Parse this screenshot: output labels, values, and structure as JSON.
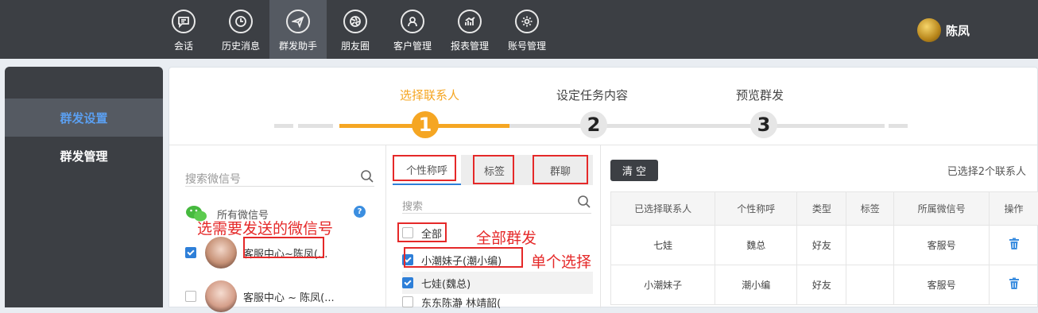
{
  "nav": {
    "items": [
      {
        "label": "会话",
        "icon": "chat-icon"
      },
      {
        "label": "历史消息",
        "icon": "clock-icon"
      },
      {
        "label": "群发助手",
        "icon": "paper-plane-icon",
        "active": true
      },
      {
        "label": "朋友圈",
        "icon": "aperture-icon"
      },
      {
        "label": "客户管理",
        "icon": "user-icon"
      },
      {
        "label": "报表管理",
        "icon": "chart-icon"
      },
      {
        "label": "账号管理",
        "icon": "gear-icon"
      }
    ],
    "user_name": "陈凤"
  },
  "sidebar": {
    "items": [
      {
        "label": "群发设置",
        "active": true
      },
      {
        "label": "群发管理",
        "active": false
      }
    ]
  },
  "steps": [
    {
      "label": "选择联系人",
      "number": "1",
      "active": true
    },
    {
      "label": "设定任务内容",
      "number": "2",
      "active": false
    },
    {
      "label": "预览群发",
      "number": "3",
      "active": false
    }
  ],
  "accounts_panel": {
    "search_placeholder": "搜索微信号",
    "all_label": "所有微信号",
    "help": "?",
    "note": "选需要发送的微信号",
    "accounts": [
      {
        "name": "客服中心~陈凤(...",
        "checked": true
      },
      {
        "name": "客服中心 ~ 陈凤(...",
        "checked": false
      }
    ]
  },
  "contacts_panel": {
    "tabs": [
      "个性称呼",
      "标签",
      "群聊"
    ],
    "search_placeholder": "搜索",
    "all_label": "全部",
    "note_all": "全部群发",
    "note_single": "单个选择",
    "items": [
      {
        "label": "小潮妹子(潮小编)",
        "checked": true
      },
      {
        "label": "七娃(魏总)",
        "checked": true
      },
      {
        "label": "东东陈瀞 林靖韶(",
        "checked": false
      }
    ]
  },
  "selected_panel": {
    "clear_label": "清 空",
    "count_text": "已选择2个联系人",
    "columns": [
      "已选择联系人",
      "个性称呼",
      "类型",
      "标签",
      "所属微信号",
      "操作"
    ],
    "rows": [
      [
        "七娃",
        "魏总",
        "好友",
        "",
        "客服号"
      ],
      [
        "小潮妹子",
        "潮小编",
        "好友",
        "",
        "客服号"
      ]
    ]
  },
  "colors": {
    "accent": "#f5a623",
    "nav_bg": "#3c3f44",
    "link_blue": "#2e7fd8",
    "annotation_red": "#e52929"
  }
}
